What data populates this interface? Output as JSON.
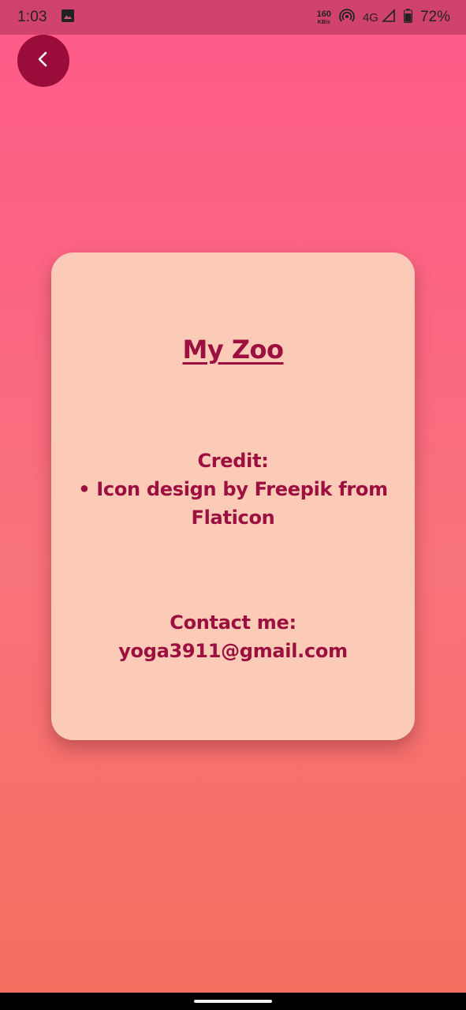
{
  "status_bar": {
    "time": "1:03",
    "net_speed_value": "160",
    "net_speed_unit": "KB/s",
    "network_type": "4G",
    "battery_percent": "72%"
  },
  "back_button": {
    "icon": "chevron-left-icon"
  },
  "card": {
    "title": "My Zoo",
    "credit_heading": "Credit:",
    "credit_line_1": "• Icon design by Freepik from",
    "credit_line_2": "Flaticon",
    "contact_heading": "Contact me:",
    "contact_email": "yoga3911@gmail.com"
  },
  "colors": {
    "background_top": "#ff5a8a",
    "background_bottom": "#f56f5e",
    "card_background": "#fccbb8",
    "accent": "#9c0f3e",
    "back_button": "#9a0c3a"
  }
}
